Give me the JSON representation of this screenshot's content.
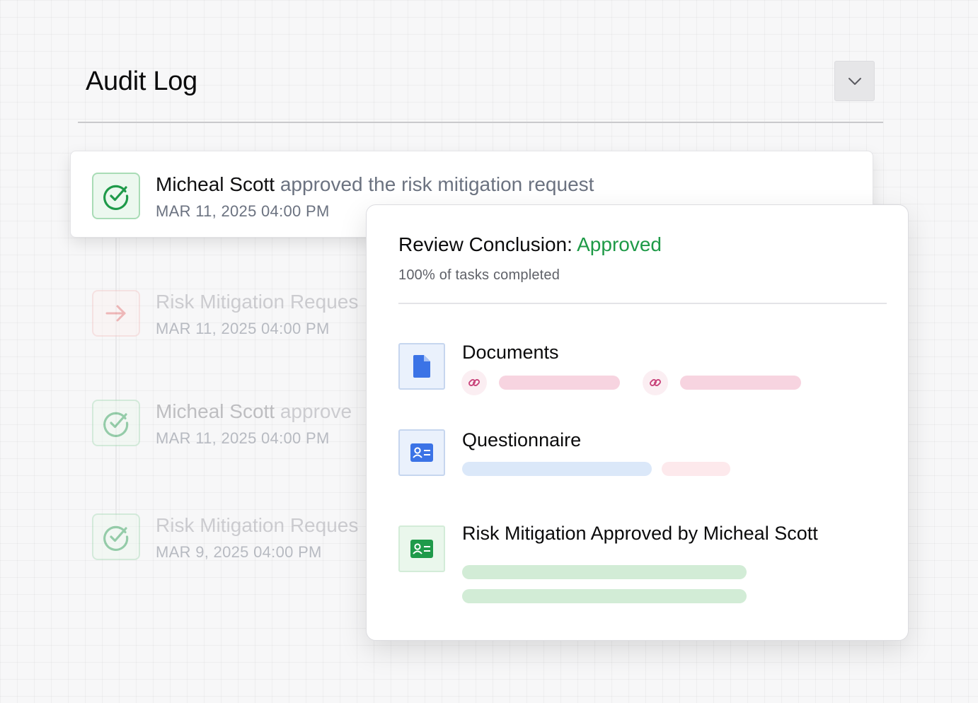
{
  "header": {
    "title": "Audit Log",
    "collapse_icon": "chevron-down-icon"
  },
  "log_entries": [
    {
      "icon": "check-circle-icon",
      "actor": "Micheal Scott",
      "action": " approved the risk mitigation request",
      "date": "MAR 11, 2025 04:00 PM"
    },
    {
      "icon": "arrow-right-icon",
      "actor": "",
      "action": "Risk Mitigation Reques",
      "date": "MAR 11, 2025 04:00 PM"
    },
    {
      "icon": "check-circle-icon",
      "actor": "Micheal Scott",
      "action": " approve",
      "date": "MAR 11, 2025 04:00 PM"
    },
    {
      "icon": "check-circle-icon",
      "actor": "",
      "action": "Risk Mitigation Reques",
      "date": "MAR 9, 2025 04:00 PM"
    }
  ],
  "review": {
    "title_prefix": "Review Conclusion: ",
    "status": "Approved",
    "progress_text": "100% of tasks completed",
    "sections": [
      {
        "label": "Documents",
        "icon": "document-icon"
      },
      {
        "label": "Questionnaire",
        "icon": "contact-card-icon"
      },
      {
        "label": "Risk Mitigation Approved by Micheal Scott",
        "icon": "contact-card-icon"
      }
    ]
  },
  "colors": {
    "approved": "#1e9a47",
    "doc_blue": "#3b73e6",
    "card_green": "#1f9a4a",
    "link_pink": "#c8437a"
  }
}
